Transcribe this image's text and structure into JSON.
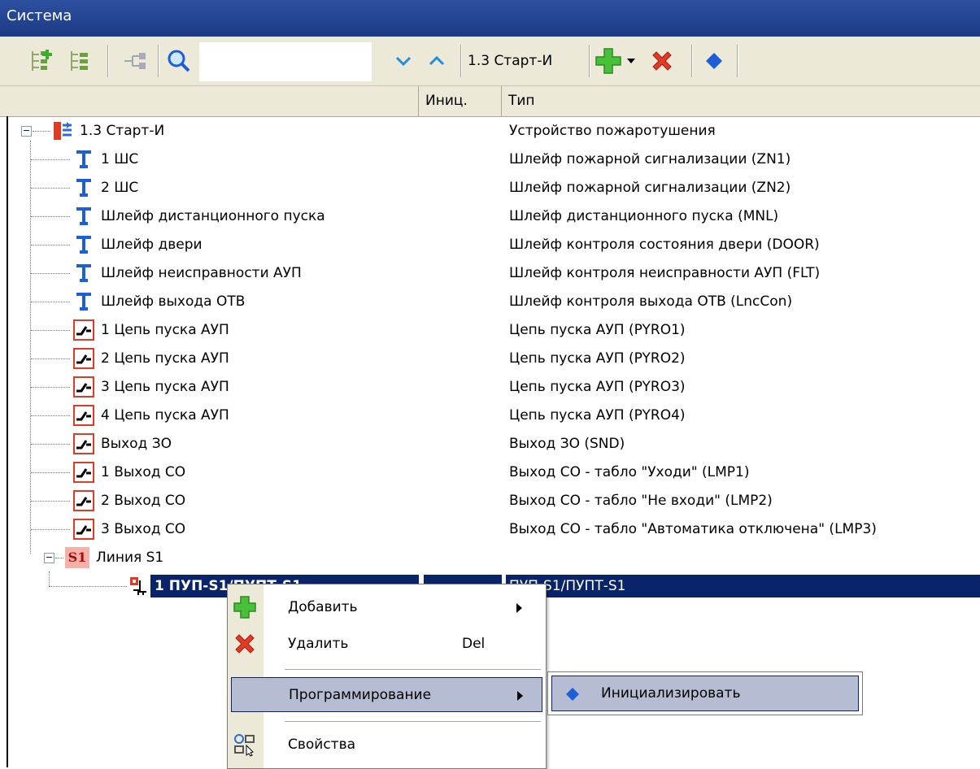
{
  "window": {
    "title": "Система"
  },
  "toolbar": {
    "icons": [
      "add-child-icon",
      "tree-view-icon",
      "hierarchy-icon",
      "search-icon",
      "arrow-down-icon",
      "arrow-up-icon",
      "add-icon",
      "delete-icon",
      "initialize-icon"
    ],
    "search_value": "",
    "current_device": "1.3 Старт-И"
  },
  "columns": {
    "name": "",
    "init": "Иниц.",
    "type": "Тип"
  },
  "tree": {
    "root": {
      "name": "1.3 Старт-И",
      "type": "Устройство пожаротушения"
    },
    "items": [
      {
        "name": "1 ШС",
        "type": "Шлейф пожарной сигнализации (ZN1)"
      },
      {
        "name": "2 ШС",
        "type": "Шлейф пожарной сигнализации (ZN2)"
      },
      {
        "name": "Шлейф дистанционного пуска",
        "type": "Шлейф дистанционного пуска (MNL)"
      },
      {
        "name": "Шлейф двери",
        "type": "Шлейф контроля состояния двери (DOOR)"
      },
      {
        "name": "Шлейф неисправности АУП",
        "type": "Шлейф контроля неисправности АУП (FLT)"
      },
      {
        "name": "Шлейф выхода ОТВ",
        "type": "Шлейф контроля выхода ОТВ (LncCon)"
      },
      {
        "name": "1 Цепь пуска АУП",
        "type": "Цепь пуска АУП (PYRO1)"
      },
      {
        "name": "2 Цепь пуска АУП",
        "type": "Цепь пуска АУП (PYRO2)"
      },
      {
        "name": "3 Цепь пуска АУП",
        "type": "Цепь пуска АУП (PYRO3)"
      },
      {
        "name": "4 Цепь пуска АУП",
        "type": "Цепь пуска АУП (PYRO4)"
      },
      {
        "name": "Выход ЗО",
        "type": "Выход ЗО (SND)"
      },
      {
        "name": "1 Выход СО",
        "type": "Выход СО - табло \"Уходи\" (LMP1)"
      },
      {
        "name": "2 Выход СО",
        "type": "Выход СО - табло \"Не входи\" (LMP2)"
      },
      {
        "name": "3 Выход СО",
        "type": "Выход СО - табло \"Автоматика отключена\" (LMP3)"
      }
    ],
    "line": {
      "badge": "S1",
      "name": "Линия S1"
    },
    "selected": {
      "name": "1 ПУП-S1/ПУПТ-S1",
      "init": "-",
      "type": "ПУП-S1/ПУПТ-S1"
    }
  },
  "context_menu": {
    "add": "Добавить",
    "delete": "Удалить",
    "delete_shortcut": "Del",
    "programming": "Программирование",
    "properties": "Свойства"
  },
  "submenu": {
    "initialize": "Инициализировать"
  },
  "colors": {
    "selection": "#0a246a",
    "titlebar": "#1b3a84",
    "menu_highlight": "#b6bdd2",
    "accent_red": "#e03b24",
    "accent_blue": "#1c5fd6"
  }
}
